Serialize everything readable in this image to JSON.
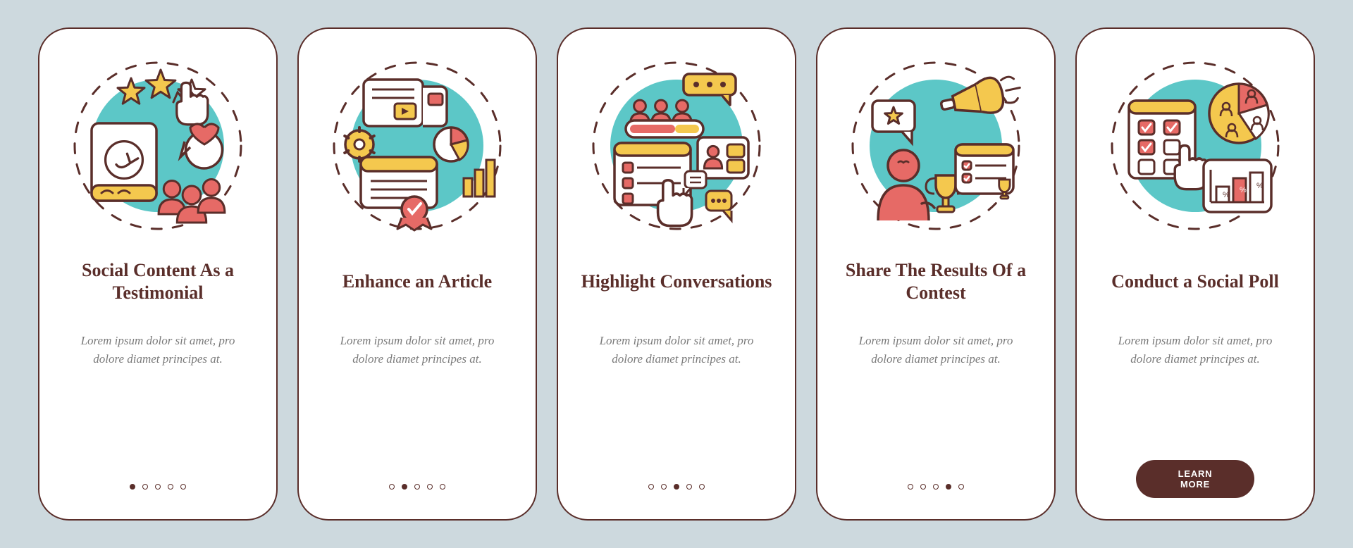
{
  "colors": {
    "stroke": "#5a2e2a",
    "red": "#e66a66",
    "yellow": "#f4c84e",
    "teal": "#5cc7c7",
    "white": "#ffffff",
    "grey": "#7a7a7a",
    "bg": "#cdd9de"
  },
  "screens": [
    {
      "id": "testimonial",
      "title": "Social Content As a Testimonial",
      "body": "Lorem ipsum dolor sit amet, pro dolore diamet principes at.",
      "icon": "testimonial-illustration",
      "has_cta": false
    },
    {
      "id": "enhance-article",
      "title": "Enhance an Article",
      "body": "Lorem ipsum dolor sit amet, pro dolore diamet principes at.",
      "icon": "article-illustration",
      "has_cta": false
    },
    {
      "id": "highlight-conversations",
      "title": "Highlight Conversations",
      "body": "Lorem ipsum dolor sit amet, pro dolore diamet principes at.",
      "icon": "conversations-illustration",
      "has_cta": false
    },
    {
      "id": "share-contest",
      "title": "Share The Results Of a Contest",
      "body": "Lorem ipsum dolor sit amet, pro dolore diamet principes at.",
      "icon": "contest-illustration",
      "has_cta": false
    },
    {
      "id": "social-poll",
      "title": "Conduct a Social Poll",
      "body": "Lorem ipsum dolor sit amet, pro dolore diamet principes at.",
      "icon": "poll-illustration",
      "has_cta": true
    }
  ],
  "cta_label": "LEARN MORE",
  "total_pages": 5
}
